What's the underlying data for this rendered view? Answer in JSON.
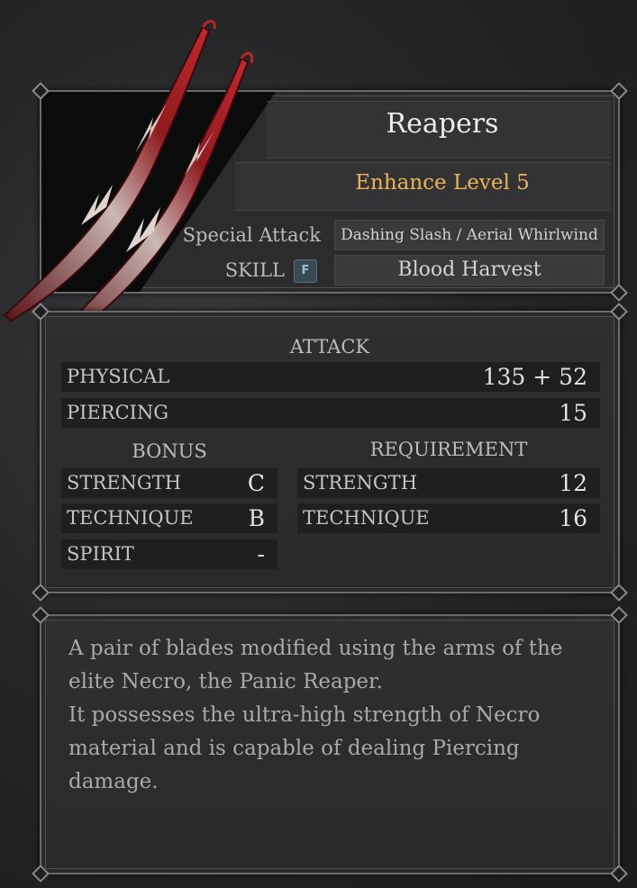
{
  "item": {
    "name": "Reapers",
    "enhance": "Enhance Level 5",
    "special_attack_label": "Special Attack",
    "special_attack_value": "Dashing Slash / Aerial Whirlwind",
    "skill_label": "SKILL",
    "skill_key": "F",
    "skill_value": "Blood Harvest"
  },
  "stats": {
    "attack_title": "ATTACK",
    "attack_rows": [
      {
        "label": "PHYSICAL",
        "value": "135 + 52"
      },
      {
        "label": "PIERCING",
        "value": "15"
      }
    ],
    "bonus_title": "BONUS",
    "bonus_rows": [
      {
        "label": "STRENGTH",
        "value": "C"
      },
      {
        "label": "TECHNIQUE",
        "value": "B"
      },
      {
        "label": "SPIRIT",
        "value": "-"
      }
    ],
    "requirement_title": "REQUIREMENT",
    "requirement_rows": [
      {
        "label": "STRENGTH",
        "value": "12"
      },
      {
        "label": "TECHNIQUE",
        "value": "16"
      }
    ]
  },
  "description": {
    "line1": "A pair of blades modified using the arms of the",
    "line2": "elite Necro, the Panic Reaper.",
    "line3": "It possesses the ultra-high strength of Necro",
    "line4": "material and is capable of dealing Piercing",
    "line5": "damage."
  },
  "colors": {
    "accent_gold": "#e8b45a",
    "blade_red": "#8e1a1f"
  },
  "icons": {
    "weapon": "reapers-blades-icon"
  }
}
